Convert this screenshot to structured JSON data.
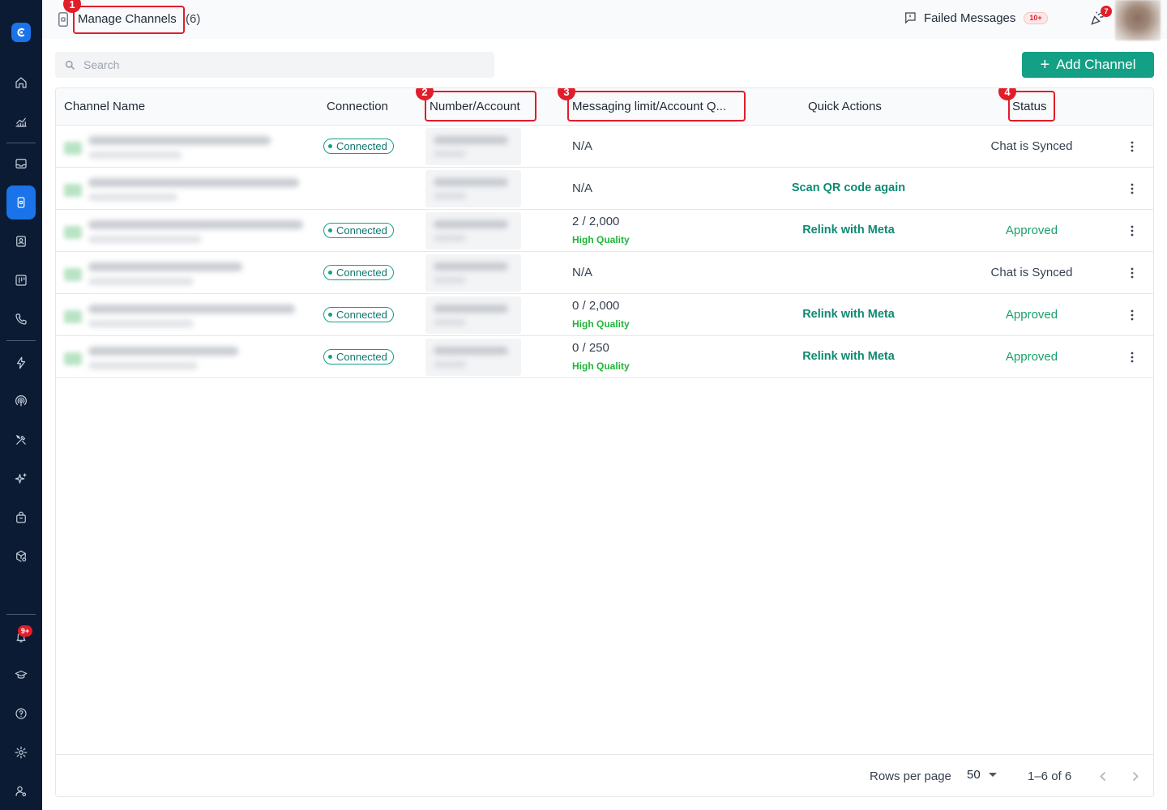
{
  "header": {
    "title": "Manage Channels",
    "count": "(6)",
    "failed_label": "Failed Messages",
    "failed_badge": "10+",
    "party_badge": "7"
  },
  "sidebar": {
    "notifications_badge": "9+"
  },
  "annotations": [
    "1",
    "2",
    "3",
    "4"
  ],
  "search": {
    "placeholder": "Search"
  },
  "add_button": {
    "label": "Add Channel"
  },
  "table": {
    "columns": [
      "Channel Name",
      "Connection",
      "Number/Account",
      "Messaging limit/Account Q...",
      "Quick Actions",
      "Status"
    ],
    "rows": [
      {
        "connection": "Connected",
        "limit": "N/A",
        "quality": "",
        "action": "",
        "status": "Chat is Synced"
      },
      {
        "connection": "",
        "limit": "N/A",
        "quality": "",
        "action": "Scan QR code again",
        "status": ""
      },
      {
        "connection": "Connected",
        "limit": "2 / 2,000",
        "quality": "High Quality",
        "action": "Relink with Meta",
        "status": "Approved"
      },
      {
        "connection": "Connected",
        "limit": "N/A",
        "quality": "",
        "action": "",
        "status": "Chat is Synced"
      },
      {
        "connection": "Connected",
        "limit": "0 / 2,000",
        "quality": "High Quality",
        "action": "Relink with Meta",
        "status": "Approved"
      },
      {
        "connection": "Connected",
        "limit": "0 / 250",
        "quality": "High Quality",
        "action": "Relink with Meta",
        "status": "Approved"
      }
    ]
  },
  "footer": {
    "rows_per_page_label": "Rows per page",
    "rows_per_page_value": "50",
    "range": "1–6 of 6"
  },
  "colors": {
    "sidebar_bg": "#0b1b33",
    "brand_blue": "#1a73e8",
    "accent_teal": "#13a085",
    "annotation_red": "#e11d2a",
    "quality_green": "#22b53b"
  }
}
